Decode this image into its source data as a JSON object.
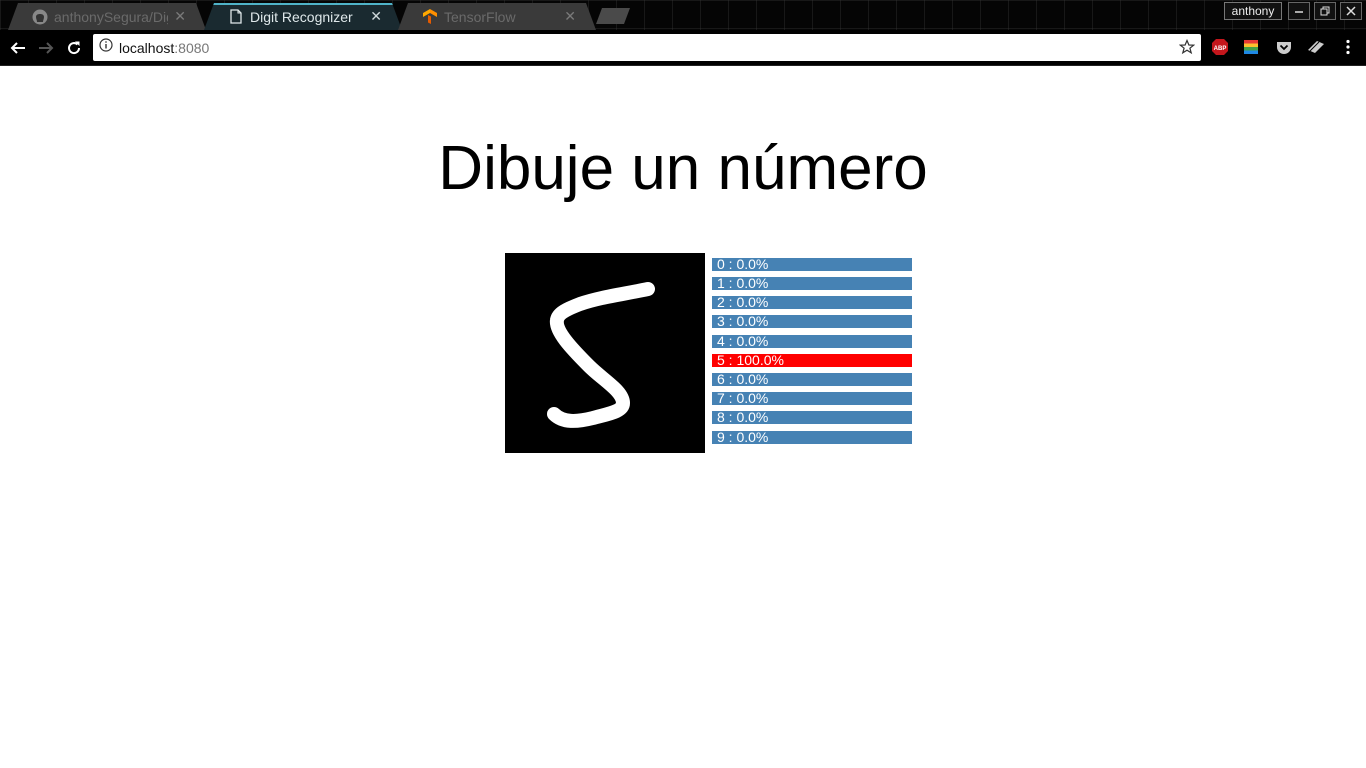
{
  "browser": {
    "tabs": [
      {
        "title": "anthonySegura/Dig",
        "icon": "github-icon",
        "active": false
      },
      {
        "title": "Digit Recognizer",
        "icon": "document-icon",
        "active": true
      },
      {
        "title": "TensorFlow",
        "icon": "tensorflow-icon",
        "active": false
      }
    ],
    "profile_name": "anthony",
    "url_host": "localhost",
    "url_port": ":8080",
    "extensions": [
      "adblock-icon",
      "color-extension-icon",
      "pocket-icon",
      "extension-icon"
    ],
    "colors": {
      "active_tab_accent": "#4fb3c8",
      "adblock": "#c4161c"
    }
  },
  "page": {
    "title": "Dibuje un número",
    "canvas_digit": "5",
    "predictions": [
      {
        "label": "0 : 0.0%",
        "value": 0.0
      },
      {
        "label": "1 : 0.0%",
        "value": 0.0
      },
      {
        "label": "2 : 0.0%",
        "value": 0.0
      },
      {
        "label": "3 : 0.0%",
        "value": 0.0
      },
      {
        "label": "4 : 0.0%",
        "value": 0.0
      },
      {
        "label": "5 : 100.0%",
        "value": 100.0
      },
      {
        "label": "6 : 0.0%",
        "value": 0.0
      },
      {
        "label": "7 : 0.0%",
        "value": 0.0
      },
      {
        "label": "8 : 0.0%",
        "value": 0.0
      },
      {
        "label": "9 : 0.0%",
        "value": 0.0
      }
    ],
    "colors": {
      "bar": "#4682b4",
      "top_bar": "#ff0000",
      "canvas_bg": "#000000",
      "stroke": "#ffffff"
    }
  }
}
